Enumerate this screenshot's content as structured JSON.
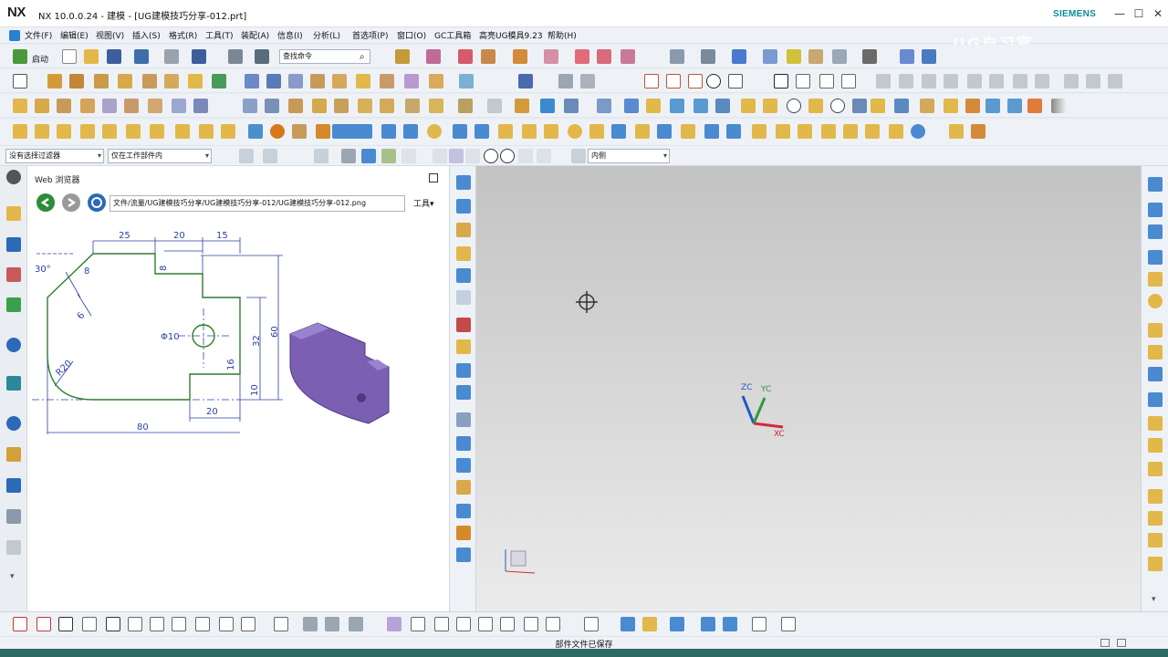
{
  "titlebar": {
    "logo": "NX",
    "title": "NX 10.0.0.24 - 建模 - [UG建模技巧分享-012.prt]",
    "brand": "SIEMENS",
    "min": "—",
    "max": "☐",
    "close": "✕"
  },
  "watermark": "UG自习室",
  "menu": {
    "items": [
      "文件(F)",
      "编辑(E)",
      "视图(V)",
      "插入(S)",
      "格式(R)",
      "工具(T)",
      "装配(A)",
      "信息(I)",
      "分析(L)",
      "首选项(P)",
      "窗口(O)",
      "GC工具箱",
      "高亮UG模具9.23",
      "帮助(H)"
    ]
  },
  "toolbar1": {
    "start_label": "启动",
    "search_placeholder": "查找命令"
  },
  "selection_bar": {
    "filter": "没有选择过滤器",
    "scope": "仅在工作部件内",
    "side": "内侧"
  },
  "browser": {
    "title": "Web 浏览器",
    "url": "文件/流量/UG建模技巧分享/UG建模技巧分享-012/UG建模技巧分享-012.png",
    "tools_label": "工具▾"
  },
  "drawing": {
    "dims": [
      "25",
      "20",
      "15",
      "8",
      "30°",
      "8",
      "6",
      "R20",
      "Φ10",
      "32",
      "60",
      "16",
      "10",
      "20",
      "80"
    ]
  },
  "triad": {
    "zc": "ZC",
    "yc": "YC",
    "xc": "XC"
  },
  "status": {
    "text": "部件文件已保存"
  },
  "colors": {
    "accent": "#2a7fd0",
    "model_purple": "#7b5fb3",
    "sketch_green": "#2e7d2e",
    "dim_blue": "#2b3fa8"
  }
}
